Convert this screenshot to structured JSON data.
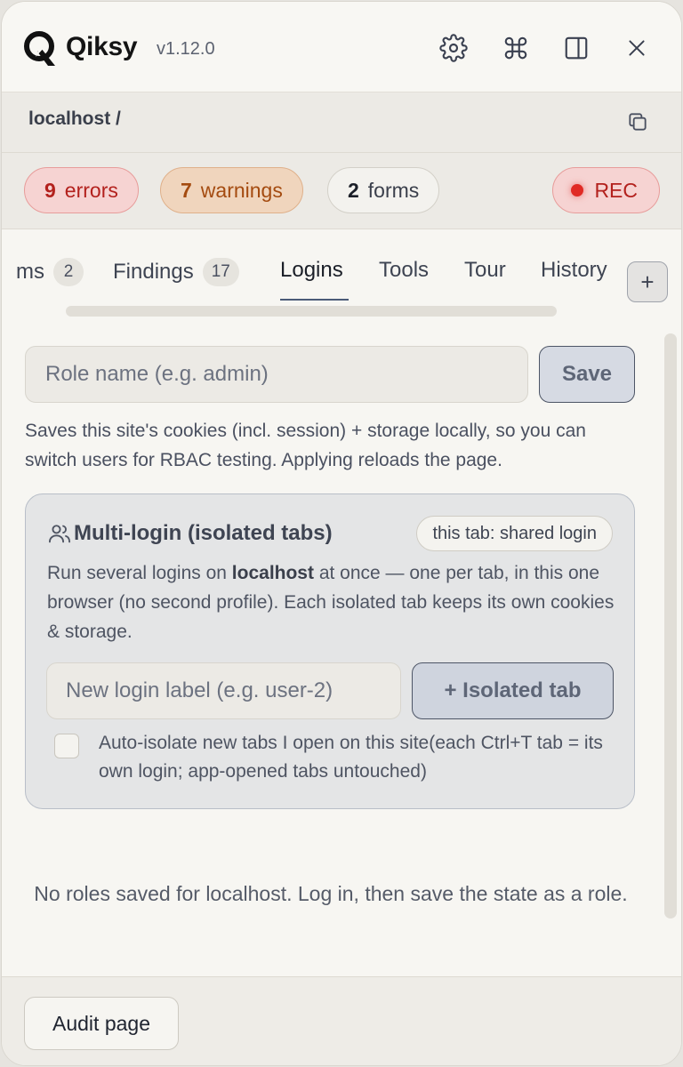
{
  "header": {
    "brand": "Qiksy",
    "version": "v1.12.0",
    "icons": [
      "gear-icon",
      "command-icon",
      "sidebar-panel-icon",
      "close-icon"
    ]
  },
  "breadcrumb": {
    "host": "localhost /"
  },
  "badges": {
    "errors": {
      "count": "9",
      "label": "errors"
    },
    "warnings": {
      "count": "7",
      "label": "warnings"
    },
    "forms": {
      "count": "2",
      "label": "forms"
    },
    "rec": "REC"
  },
  "tabs": [
    {
      "label": "ms",
      "count": "2"
    },
    {
      "label": "Findings",
      "count": "17"
    },
    {
      "label": "Logins"
    },
    {
      "label": "Tools"
    },
    {
      "label": "Tour"
    },
    {
      "label": "History"
    }
  ],
  "tab_add": "+",
  "active_tab": "Logins",
  "logins": {
    "role_placeholder": "Role name (e.g. admin)",
    "save_label": "Save",
    "help": "Saves this site's cookies (incl. session) + storage locally, so you can switch users for RBAC testing. Applying reloads the page.",
    "multi": {
      "title": "Multi-login (isolated tabs)",
      "chip": "this tab: shared login",
      "desc_pre": "Run several logins on ",
      "desc_host": "localhost",
      "desc_post": " at once — one per tab, in this one browser (no second profile). Each isolated tab keeps its own cookies & storage.",
      "label_placeholder": "New login label (e.g. user-2)",
      "isolated_button": "+ Isolated tab",
      "auto_isolate_label": "Auto-isolate new tabs I open on this site(each Ctrl+T tab = its own login; app-opened tabs untouched)",
      "auto_isolate_checked": false
    },
    "empty_state": "No roles saved for localhost. Log in, then save the state as a role."
  },
  "footer": {
    "audit_label": "Audit page"
  },
  "colors": {
    "error": "#b3211d",
    "warning": "#a44b10",
    "rec_dot": "#e02a24",
    "accent": "#4a5a78"
  }
}
